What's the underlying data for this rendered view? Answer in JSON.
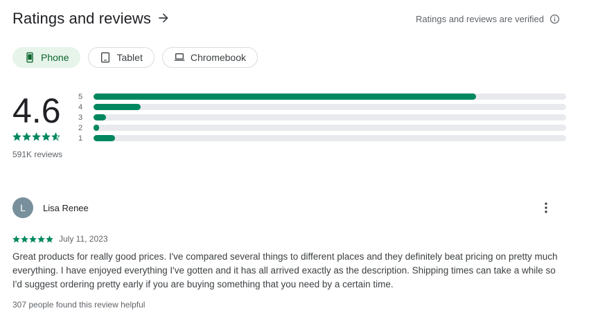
{
  "header": {
    "title": "Ratings and reviews",
    "verified_text": "Ratings and reviews are verified"
  },
  "device_tabs": [
    {
      "label": "Phone",
      "icon": "phone-icon",
      "selected": true
    },
    {
      "label": "Tablet",
      "icon": "tablet-icon",
      "selected": false
    },
    {
      "label": "Chromebook",
      "icon": "laptop-icon",
      "selected": false
    }
  ],
  "summary": {
    "rating": "4.6",
    "stars_value": 4.6,
    "review_count": "591K reviews"
  },
  "distribution": [
    {
      "label": "5",
      "fraction": 0.81
    },
    {
      "label": "4",
      "fraction": 0.1
    },
    {
      "label": "3",
      "fraction": 0.026
    },
    {
      "label": "2",
      "fraction": 0.012
    },
    {
      "label": "1",
      "fraction": 0.045
    }
  ],
  "review": {
    "avatar_letter": "L",
    "reviewer_name": "Lisa Renee",
    "stars_value": 5,
    "date": "July 11, 2023",
    "text": "Great products for really good prices. I've compared several things to different places and they definitely beat pricing on pretty much everything. I have enjoyed everything I've gotten and it has all arrived exactly as the description. Shipping times can take a while so I'd suggest ordering pretty early if you are buying something that you need by a certain time.",
    "helpful": "307 people found this review helpful"
  },
  "colors": {
    "accent": "#01875f",
    "chip_selected_bg": "#e6f4ea",
    "track": "#e8eaed",
    "avatar": "#78909c"
  }
}
